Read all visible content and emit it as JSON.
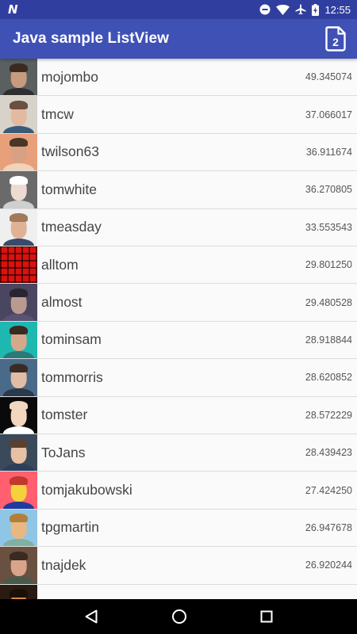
{
  "status_bar": {
    "notification_icon": "n-notification-icon",
    "icons": [
      "do-not-disturb-icon",
      "wifi-icon",
      "airplane-icon",
      "battery-charging-icon"
    ],
    "time": "12:55"
  },
  "app_bar": {
    "title": "Java sample ListView",
    "action_icon": "document-page-2-icon",
    "action_badge": "2"
  },
  "users": [
    {
      "login": "mojombo",
      "score": "49.345074",
      "avatar": {
        "bg": "#5a5f60",
        "skin": "#c79b7e",
        "hair": "#3a2a20",
        "shirt": "#2f2f2f"
      }
    },
    {
      "login": "tmcw",
      "score": "37.066017",
      "avatar": {
        "bg": "#d8d3c9",
        "skin": "#e3b9a0",
        "hair": "#6a5040",
        "shirt": "#3a5a7a"
      }
    },
    {
      "login": "twilson63",
      "score": "36.911674",
      "avatar": {
        "bg": "#e8a07a",
        "skin": "#d9a184",
        "hair": "#4a3628",
        "shirt": "#f2d2b8"
      }
    },
    {
      "login": "tomwhite",
      "score": "36.270805",
      "avatar": {
        "bg": "#6a6a6a",
        "skin": "#eddbd2",
        "hair": "#ffffff",
        "shirt": "#cfcfcf"
      }
    },
    {
      "login": "tmeasday",
      "score": "33.553543",
      "avatar": {
        "bg": "#efefef",
        "skin": "#e0b295",
        "hair": "#a07a5a",
        "shirt": "#3a4a6a"
      }
    },
    {
      "login": "alltom",
      "score": "29.801250",
      "avatar": {
        "plaid": true
      }
    },
    {
      "login": "almost",
      "score": "29.480528",
      "avatar": {
        "bg": "#4a4560",
        "skin": "#b89a90",
        "hair": "#2a2430",
        "shirt": "#5a5272"
      }
    },
    {
      "login": "tominsam",
      "score": "28.918844",
      "avatar": {
        "bg": "#1fb8b0",
        "skin": "#d6a88a",
        "hair": "#3a2a20",
        "shirt": "#2a7a7a"
      }
    },
    {
      "login": "tommorris",
      "score": "28.620852",
      "avatar": {
        "bg": "#4a6a8a",
        "skin": "#e1bda5",
        "hair": "#3a2c25",
        "shirt": "#2a3a4a"
      }
    },
    {
      "login": "tomster",
      "score": "28.572229",
      "avatar": {
        "bg": "#0a0a0a",
        "skin": "#f3d6bf",
        "hair": "#f3d6bf",
        "shirt": "#ffffff"
      }
    },
    {
      "login": "ToJans",
      "score": "28.439423",
      "avatar": {
        "bg": "#3a4a5a",
        "skin": "#e8c0a4",
        "hair": "#5a4030",
        "shirt": "#2e3e5a"
      }
    },
    {
      "login": "tomjakubowski",
      "score": "27.424250",
      "avatar": {
        "bg": "#ff5f6e",
        "skin": "#f5d23a",
        "hair": "#c0392b",
        "shirt": "#1f3aa0"
      }
    },
    {
      "login": "tpgmartin",
      "score": "26.947678",
      "avatar": {
        "bg": "#8fc6e6",
        "skin": "#e8b880",
        "hair": "#b0803a",
        "shirt": "#7fb0a0"
      }
    },
    {
      "login": "tnajdek",
      "score": "26.920244",
      "avatar": {
        "bg": "#6a5040",
        "skin": "#d9a58a",
        "hair": "#3a2a20",
        "shirt": "#4a5a4a"
      }
    },
    {
      "login": "",
      "score": "",
      "avatar": {
        "bg": "#2a1a12",
        "skin": "#d98a40",
        "hair": "#1a100a",
        "shirt": "#2a1a12"
      }
    }
  ],
  "nav_bar": {
    "icons": [
      "back-triangle-icon",
      "home-circle-icon",
      "recents-square-icon"
    ]
  },
  "colors": {
    "status_bar": "#303f9f",
    "app_bar": "#3f51b5",
    "list_bg": "#fafafa",
    "divider": "#dcdcdc",
    "nav_bar": "#000000"
  }
}
